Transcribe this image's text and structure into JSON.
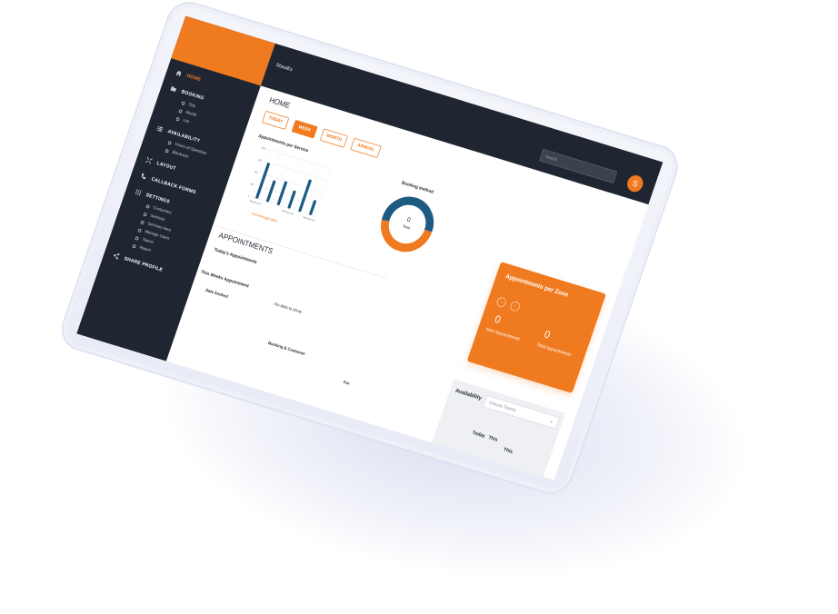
{
  "app": {
    "brand": "ShoutEx",
    "avatar_initial": "S"
  },
  "colors": {
    "accent": "#f07a1f",
    "dark": "#1f2631",
    "chart_blue": "#1c5a82"
  },
  "sidebar": {
    "items": [
      {
        "label": "HOME",
        "icon": "home-icon",
        "active": true,
        "subs": []
      },
      {
        "label": "BOOKING",
        "icon": "booking-icon",
        "subs": [
          "Day",
          "Month",
          "List"
        ]
      },
      {
        "label": "AVAILABILITY",
        "icon": "list-icon",
        "subs": [
          "Hours of Operation",
          "Blackouts"
        ]
      },
      {
        "label": "LAYOUT",
        "icon": "layout-icon",
        "subs": []
      },
      {
        "label": "CALLBACK FORMS",
        "icon": "phone-icon",
        "subs": []
      },
      {
        "label": "SETTINGS",
        "icon": "sliders-icon",
        "subs": [
          "Customers",
          "Services",
          "Services Area",
          "Manage Users",
          "Teams",
          "Report"
        ]
      },
      {
        "label": "SHARE PROFILE",
        "icon": "share-icon",
        "subs": []
      }
    ]
  },
  "topbar": {
    "search_placeholder": "Search"
  },
  "home": {
    "title": "HOME",
    "tabs": [
      "TODAY",
      "WEEK",
      "MONTH",
      "ANNUAL"
    ],
    "active_tab": "WEEK",
    "service_chart_title": "Appointments per Service",
    "not_enough_data": "*not enough data",
    "booking_title": "Booking method",
    "donut_value": "0",
    "donut_label": "Total",
    "zone": {
      "title": "Appointments per Zone",
      "prev": "‹",
      "next": "›",
      "new_value": "0",
      "new_label": "New Appointments",
      "total_value": "0",
      "total_label": "Total Appointments"
    }
  },
  "appointments": {
    "title": "APPOINTMENTS",
    "today": "Today's Appointments",
    "this_week": "This Weeks Appointment",
    "date_booked": "Date booked",
    "no_data": "No data to show",
    "booking_customer": "Booking & Customer",
    "for": "For"
  },
  "availability": {
    "title": "Availability",
    "select_placeholder": "Choose Teams",
    "col_today": "Today",
    "col_this": "This",
    "col_this2": "This"
  },
  "chart_data": [
    {
      "type": "bar",
      "title": "Appointments per Service",
      "categories": [
        "Services 01",
        "",
        "",
        "Services 02",
        "",
        "Services 03"
      ],
      "values": [
        120,
        72,
        80,
        60,
        108,
        50
      ],
      "yticks": [
        0,
        40,
        80,
        120,
        160
      ],
      "ylim": [
        0,
        160
      ],
      "grid": true
    },
    {
      "type": "pie",
      "title": "Booking method",
      "series": [
        {
          "value": 48,
          "color": "#f07a1f"
        },
        {
          "value": 52,
          "color": "#1c5a82"
        }
      ]
    }
  ]
}
